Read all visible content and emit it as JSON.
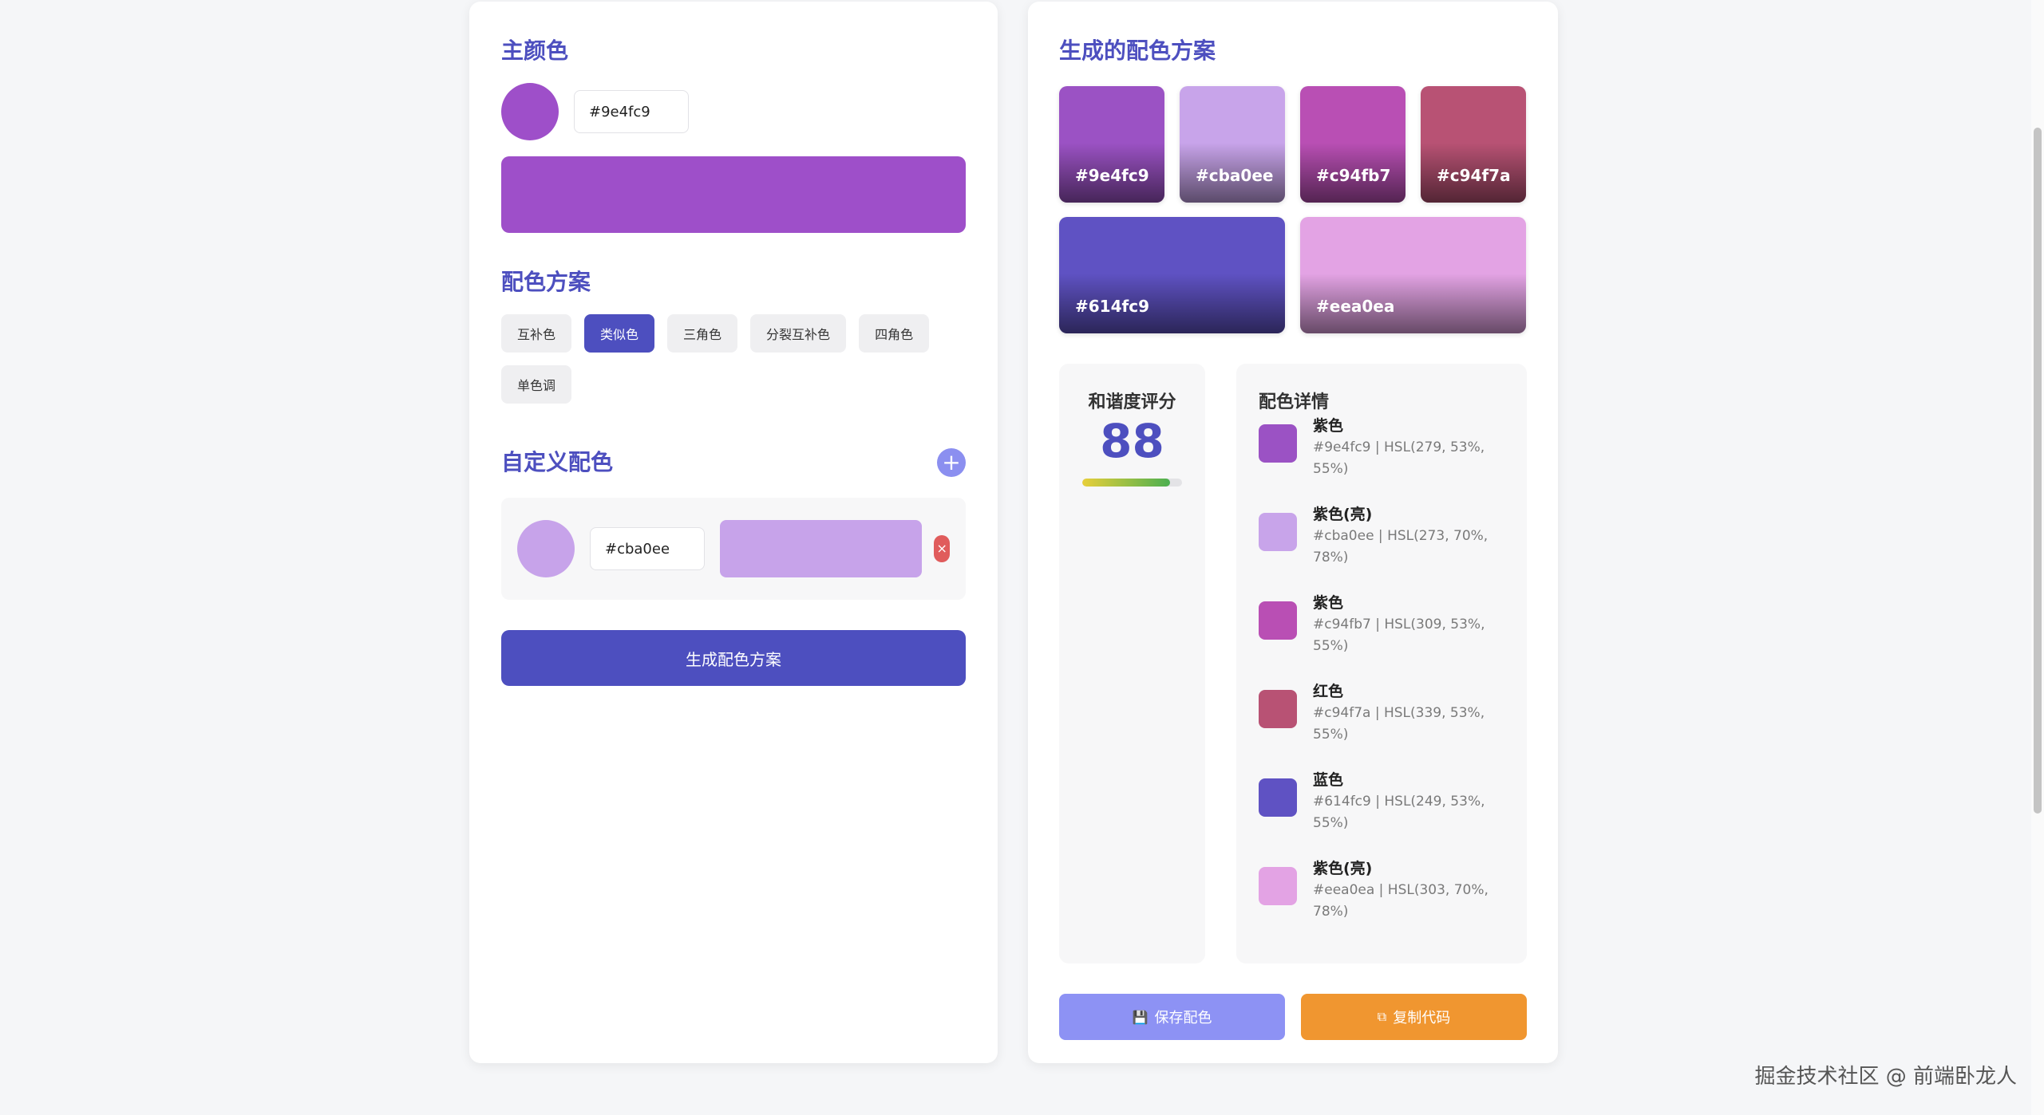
{
  "left": {
    "primary_title": "主颜色",
    "primary_color": "#9e4fc9",
    "primary_hex_value": "#9e4fc9",
    "schemes_title": "配色方案",
    "schemes": [
      {
        "label": "互补色",
        "active": false
      },
      {
        "label": "类似色",
        "active": true
      },
      {
        "label": "三角色",
        "active": false
      },
      {
        "label": "分裂互补色",
        "active": false
      },
      {
        "label": "四角色",
        "active": false
      },
      {
        "label": "单色调",
        "active": false
      }
    ],
    "custom_title": "自定义配色",
    "add_symbol": "+",
    "custom_colors": [
      {
        "hex": "#cba0ee",
        "color": "#c7a3ea"
      }
    ],
    "remove_symbol": "×",
    "generate_label": "生成配色方案"
  },
  "right": {
    "palette_title": "生成的配色方案",
    "palette": [
      {
        "hex": "#9e4fc9",
        "color": "#9b52c4"
      },
      {
        "hex": "#cba0ee",
        "color": "#c8a4ea"
      },
      {
        "hex": "#c94fb7",
        "color": "#b94fb4"
      },
      {
        "hex": "#c94f7a",
        "color": "#b85274"
      },
      {
        "hex": "#614fc9",
        "color": "#5f52c3"
      },
      {
        "hex": "#eea0ea",
        "color": "#e3a3e4"
      }
    ],
    "harmony_title": "和谐度评分",
    "harmony_score": "88",
    "harmony_percent": 88,
    "details_title": "配色详情",
    "details": [
      {
        "name": "紫色",
        "info": "#9e4fc9 | HSL(279, 53%, 55%)",
        "color": "#9b52c4"
      },
      {
        "name": "紫色(亮)",
        "info": "#cba0ee | HSL(273, 70%, 78%)",
        "color": "#c8a4ea"
      },
      {
        "name": "紫色",
        "info": "#c94fb7 | HSL(309, 53%, 55%)",
        "color": "#b94fb4"
      },
      {
        "name": "红色",
        "info": "#c94f7a | HSL(339, 53%, 55%)",
        "color": "#b85274"
      },
      {
        "name": "蓝色",
        "info": "#614fc9 | HSL(249, 53%, 55%)",
        "color": "#5f52c3"
      },
      {
        "name": "紫色(亮)",
        "info": "#eea0ea | HSL(303, 70%, 78%)",
        "color": "#e3a3e4"
      }
    ],
    "save_label": "保存配色",
    "copy_label": "复制代码"
  },
  "watermark": "掘金技术社区 @ 前端卧龙人"
}
